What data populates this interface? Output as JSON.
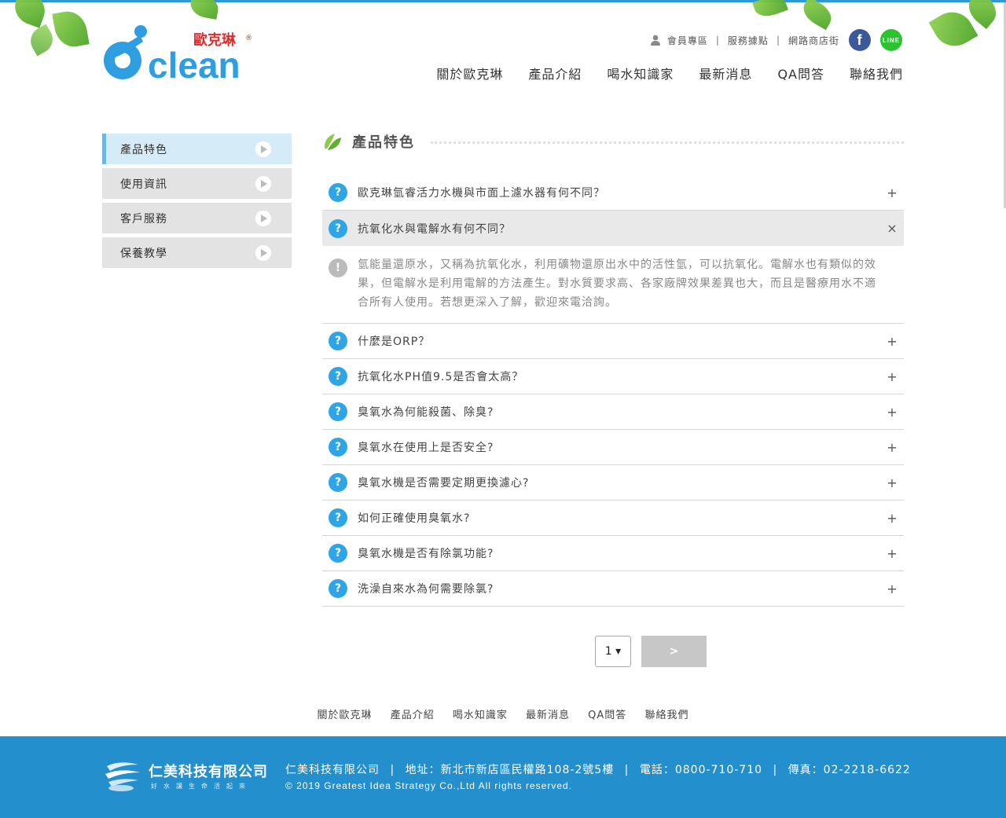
{
  "header": {
    "logo_brand_cn": "歐克琳",
    "logo_brand_en": "clean",
    "util_links": [
      "會員專區",
      "服務據點",
      "網路商店街"
    ],
    "social": {
      "facebook": "f",
      "line": "LINE"
    },
    "nav": [
      "關於歐克琳",
      "產品介紹",
      "喝水知識家",
      "最新消息",
      "QA問答",
      "聯絡我們"
    ]
  },
  "sidebar": {
    "items": [
      {
        "label": "產品特色",
        "active": true
      },
      {
        "label": "使用資訊",
        "active": false
      },
      {
        "label": "客戶服務",
        "active": false
      },
      {
        "label": "保養教學",
        "active": false
      }
    ]
  },
  "main": {
    "section_title": "產品特色",
    "faq": [
      {
        "q": "歐克琳氫睿活力水機與市面上濾水器有何不同？",
        "toggle": "+"
      },
      {
        "q": "抗氧化水與電解水有何不同？",
        "toggle": "×"
      },
      {
        "q": "什麼是ORP？",
        "toggle": "+"
      },
      {
        "q": "抗氧化水PH值9.5是否會太高？",
        "toggle": "+"
      },
      {
        "q": "臭氧水為何能殺菌、除臭?",
        "toggle": "+"
      },
      {
        "q": "臭氧水在使用上是否安全?",
        "toggle": "+"
      },
      {
        "q": "臭氧水機是否需要定期更換濾心?",
        "toggle": "+"
      },
      {
        "q": "如何正確使用臭氧水?",
        "toggle": "+"
      },
      {
        "q": "臭氧水機是否有除氯功能?",
        "toggle": "+"
      },
      {
        "q": "洗澡自來水為何需要除氯?",
        "toggle": "+"
      }
    ],
    "answer": "氫能量還原水，又稱為抗氧化水，利用礦物還原出水中的活性氫，可以抗氧化。電解水也有類似的效果，但電解水是利用電解的方法產生。對水質要求高、各家廠牌效果差異也大，而且是醫療用水不適合所有人使用。若想更深入了解，歡迎來電洽詢。",
    "q_icon": "?",
    "a_icon": "!"
  },
  "pager": {
    "page": "1 ▾",
    "next": ">"
  },
  "footer_nav": [
    "關於歐克琳",
    "產品介紹",
    "喝水知識家",
    "最新消息",
    "QA問答",
    "聯絡我們"
  ],
  "footer": {
    "company_logo": "仁美科技有限公司",
    "slogan": "好水讓生命活起來",
    "company": "仁美科技有限公司",
    "address": "地址：新北市新店區民權路108-2號5樓",
    "phone": "電話：0800-710-710",
    "fax": "傳真：02-2218-6622",
    "copyright": "© 2019 Greatest Idea Strategy Co.,Ltd All rights reserved."
  }
}
